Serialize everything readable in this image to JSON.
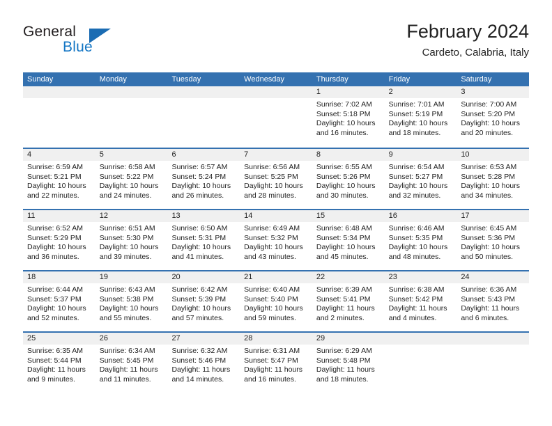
{
  "brand": {
    "line1": "General",
    "line2": "Blue",
    "logo_icon": "triangle-logo-icon",
    "color_dark": "#231f20",
    "color_blue": "#1275c4"
  },
  "header": {
    "month_title": "February 2024",
    "location": "Cardeto, Calabria, Italy"
  },
  "theme": {
    "header_blue": "#3471b0",
    "day_band_gray": "#f0f0f0",
    "text": "#222222"
  },
  "calendar": {
    "weekday_headers": [
      "Sunday",
      "Monday",
      "Tuesday",
      "Wednesday",
      "Thursday",
      "Friday",
      "Saturday"
    ],
    "weeks": [
      [
        {
          "day": "",
          "empty": true,
          "sunrise": "",
          "sunset": "",
          "daylight_line1": "",
          "daylight_line2": ""
        },
        {
          "day": "",
          "empty": true,
          "sunrise": "",
          "sunset": "",
          "daylight_line1": "",
          "daylight_line2": ""
        },
        {
          "day": "",
          "empty": true,
          "sunrise": "",
          "sunset": "",
          "daylight_line1": "",
          "daylight_line2": ""
        },
        {
          "day": "",
          "empty": true,
          "sunrise": "",
          "sunset": "",
          "daylight_line1": "",
          "daylight_line2": ""
        },
        {
          "day": "1",
          "sunrise": "Sunrise: 7:02 AM",
          "sunset": "Sunset: 5:18 PM",
          "daylight_line1": "Daylight: 10 hours",
          "daylight_line2": "and 16 minutes."
        },
        {
          "day": "2",
          "sunrise": "Sunrise: 7:01 AM",
          "sunset": "Sunset: 5:19 PM",
          "daylight_line1": "Daylight: 10 hours",
          "daylight_line2": "and 18 minutes."
        },
        {
          "day": "3",
          "sunrise": "Sunrise: 7:00 AM",
          "sunset": "Sunset: 5:20 PM",
          "daylight_line1": "Daylight: 10 hours",
          "daylight_line2": "and 20 minutes."
        }
      ],
      [
        {
          "day": "4",
          "sunrise": "Sunrise: 6:59 AM",
          "sunset": "Sunset: 5:21 PM",
          "daylight_line1": "Daylight: 10 hours",
          "daylight_line2": "and 22 minutes."
        },
        {
          "day": "5",
          "sunrise": "Sunrise: 6:58 AM",
          "sunset": "Sunset: 5:22 PM",
          "daylight_line1": "Daylight: 10 hours",
          "daylight_line2": "and 24 minutes."
        },
        {
          "day": "6",
          "sunrise": "Sunrise: 6:57 AM",
          "sunset": "Sunset: 5:24 PM",
          "daylight_line1": "Daylight: 10 hours",
          "daylight_line2": "and 26 minutes."
        },
        {
          "day": "7",
          "sunrise": "Sunrise: 6:56 AM",
          "sunset": "Sunset: 5:25 PM",
          "daylight_line1": "Daylight: 10 hours",
          "daylight_line2": "and 28 minutes."
        },
        {
          "day": "8",
          "sunrise": "Sunrise: 6:55 AM",
          "sunset": "Sunset: 5:26 PM",
          "daylight_line1": "Daylight: 10 hours",
          "daylight_line2": "and 30 minutes."
        },
        {
          "day": "9",
          "sunrise": "Sunrise: 6:54 AM",
          "sunset": "Sunset: 5:27 PM",
          "daylight_line1": "Daylight: 10 hours",
          "daylight_line2": "and 32 minutes."
        },
        {
          "day": "10",
          "sunrise": "Sunrise: 6:53 AM",
          "sunset": "Sunset: 5:28 PM",
          "daylight_line1": "Daylight: 10 hours",
          "daylight_line2": "and 34 minutes."
        }
      ],
      [
        {
          "day": "11",
          "sunrise": "Sunrise: 6:52 AM",
          "sunset": "Sunset: 5:29 PM",
          "daylight_line1": "Daylight: 10 hours",
          "daylight_line2": "and 36 minutes."
        },
        {
          "day": "12",
          "sunrise": "Sunrise: 6:51 AM",
          "sunset": "Sunset: 5:30 PM",
          "daylight_line1": "Daylight: 10 hours",
          "daylight_line2": "and 39 minutes."
        },
        {
          "day": "13",
          "sunrise": "Sunrise: 6:50 AM",
          "sunset": "Sunset: 5:31 PM",
          "daylight_line1": "Daylight: 10 hours",
          "daylight_line2": "and 41 minutes."
        },
        {
          "day": "14",
          "sunrise": "Sunrise: 6:49 AM",
          "sunset": "Sunset: 5:32 PM",
          "daylight_line1": "Daylight: 10 hours",
          "daylight_line2": "and 43 minutes."
        },
        {
          "day": "15",
          "sunrise": "Sunrise: 6:48 AM",
          "sunset": "Sunset: 5:34 PM",
          "daylight_line1": "Daylight: 10 hours",
          "daylight_line2": "and 45 minutes."
        },
        {
          "day": "16",
          "sunrise": "Sunrise: 6:46 AM",
          "sunset": "Sunset: 5:35 PM",
          "daylight_line1": "Daylight: 10 hours",
          "daylight_line2": "and 48 minutes."
        },
        {
          "day": "17",
          "sunrise": "Sunrise: 6:45 AM",
          "sunset": "Sunset: 5:36 PM",
          "daylight_line1": "Daylight: 10 hours",
          "daylight_line2": "and 50 minutes."
        }
      ],
      [
        {
          "day": "18",
          "sunrise": "Sunrise: 6:44 AM",
          "sunset": "Sunset: 5:37 PM",
          "daylight_line1": "Daylight: 10 hours",
          "daylight_line2": "and 52 minutes."
        },
        {
          "day": "19",
          "sunrise": "Sunrise: 6:43 AM",
          "sunset": "Sunset: 5:38 PM",
          "daylight_line1": "Daylight: 10 hours",
          "daylight_line2": "and 55 minutes."
        },
        {
          "day": "20",
          "sunrise": "Sunrise: 6:42 AM",
          "sunset": "Sunset: 5:39 PM",
          "daylight_line1": "Daylight: 10 hours",
          "daylight_line2": "and 57 minutes."
        },
        {
          "day": "21",
          "sunrise": "Sunrise: 6:40 AM",
          "sunset": "Sunset: 5:40 PM",
          "daylight_line1": "Daylight: 10 hours",
          "daylight_line2": "and 59 minutes."
        },
        {
          "day": "22",
          "sunrise": "Sunrise: 6:39 AM",
          "sunset": "Sunset: 5:41 PM",
          "daylight_line1": "Daylight: 11 hours",
          "daylight_line2": "and 2 minutes."
        },
        {
          "day": "23",
          "sunrise": "Sunrise: 6:38 AM",
          "sunset": "Sunset: 5:42 PM",
          "daylight_line1": "Daylight: 11 hours",
          "daylight_line2": "and 4 minutes."
        },
        {
          "day": "24",
          "sunrise": "Sunrise: 6:36 AM",
          "sunset": "Sunset: 5:43 PM",
          "daylight_line1": "Daylight: 11 hours",
          "daylight_line2": "and 6 minutes."
        }
      ],
      [
        {
          "day": "25",
          "sunrise": "Sunrise: 6:35 AM",
          "sunset": "Sunset: 5:44 PM",
          "daylight_line1": "Daylight: 11 hours",
          "daylight_line2": "and 9 minutes."
        },
        {
          "day": "26",
          "sunrise": "Sunrise: 6:34 AM",
          "sunset": "Sunset: 5:45 PM",
          "daylight_line1": "Daylight: 11 hours",
          "daylight_line2": "and 11 minutes."
        },
        {
          "day": "27",
          "sunrise": "Sunrise: 6:32 AM",
          "sunset": "Sunset: 5:46 PM",
          "daylight_line1": "Daylight: 11 hours",
          "daylight_line2": "and 14 minutes."
        },
        {
          "day": "28",
          "sunrise": "Sunrise: 6:31 AM",
          "sunset": "Sunset: 5:47 PM",
          "daylight_line1": "Daylight: 11 hours",
          "daylight_line2": "and 16 minutes."
        },
        {
          "day": "29",
          "sunrise": "Sunrise: 6:29 AM",
          "sunset": "Sunset: 5:48 PM",
          "daylight_line1": "Daylight: 11 hours",
          "daylight_line2": "and 18 minutes."
        },
        {
          "day": "",
          "empty": true,
          "sunrise": "",
          "sunset": "",
          "daylight_line1": "",
          "daylight_line2": ""
        },
        {
          "day": "",
          "empty": true,
          "sunrise": "",
          "sunset": "",
          "daylight_line1": "",
          "daylight_line2": ""
        }
      ]
    ]
  }
}
